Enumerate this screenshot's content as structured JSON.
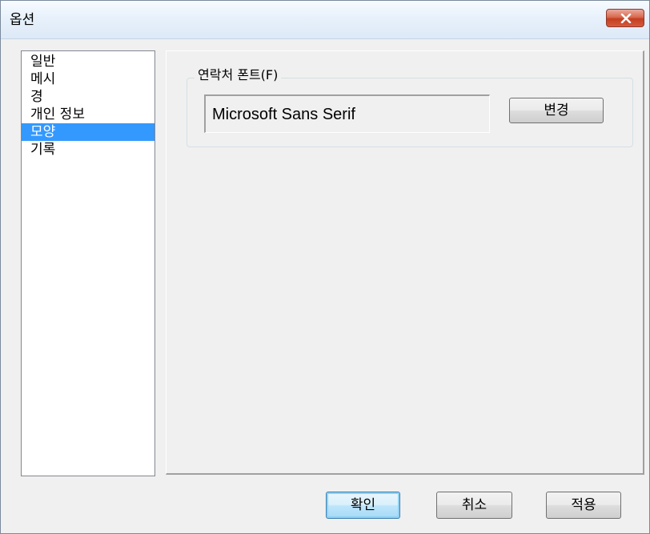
{
  "window": {
    "title": "옵션"
  },
  "sidebar": {
    "items": [
      {
        "label": "일반"
      },
      {
        "label": "메시"
      },
      {
        "label": "경"
      },
      {
        "label": "개인 정보"
      },
      {
        "label": "모양"
      },
      {
        "label": "기록"
      }
    ],
    "selected_index": 4
  },
  "appearance": {
    "group_label": "연락처 폰트(F)",
    "font_value": "Microsoft Sans Serif",
    "change_label": "변경"
  },
  "footer": {
    "ok_label": "확인",
    "cancel_label": "취소",
    "apply_label": "적용"
  },
  "colors": {
    "selection": "#3399ff",
    "close_button": "#c9452a"
  }
}
